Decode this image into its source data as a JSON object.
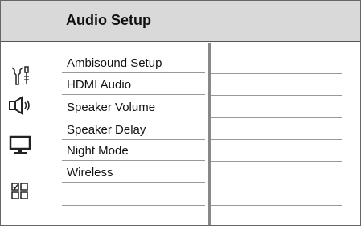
{
  "header": {
    "title": "Audio Setup"
  },
  "sidebar": {
    "icons": [
      {
        "name": "general-setup-icon"
      },
      {
        "name": "speaker-icon"
      },
      {
        "name": "monitor-icon"
      },
      {
        "name": "preferences-icon"
      }
    ]
  },
  "menu": {
    "items": [
      {
        "label": "Ambisound Setup"
      },
      {
        "label": "HDMI Audio"
      },
      {
        "label": "Speaker Volume"
      },
      {
        "label": "Speaker Delay"
      },
      {
        "label": "Night Mode"
      },
      {
        "label": "Wireless"
      }
    ]
  }
}
